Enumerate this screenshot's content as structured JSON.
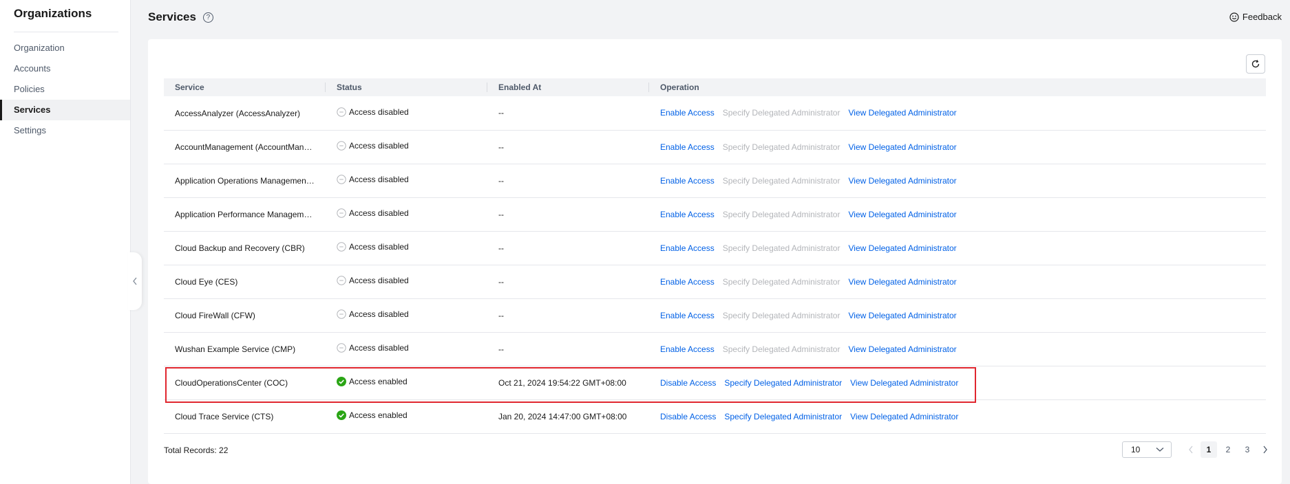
{
  "sidebar": {
    "title": "Organizations",
    "items": [
      {
        "label": "Organization"
      },
      {
        "label": "Accounts"
      },
      {
        "label": "Policies"
      },
      {
        "label": "Services"
      },
      {
        "label": "Settings"
      }
    ],
    "active_index": 3
  },
  "header": {
    "title": "Services",
    "help_icon": "question-icon",
    "feedback_label": "Feedback"
  },
  "table": {
    "columns": [
      "Service",
      "Status",
      "Enabled At",
      "Operation"
    ],
    "rows": [
      {
        "service": "AccessAnalyzer (AccessAnalyzer)",
        "status": "Access disabled",
        "enabled_at": "--",
        "op1": "Enable Access",
        "op2": "Specify Delegated Administrator",
        "op3": "View Delegated Administrator"
      },
      {
        "service": "AccountManagement (AccountManagement)",
        "status": "Access disabled",
        "enabled_at": "--",
        "op1": "Enable Access",
        "op2": "Specify Delegated Administrator",
        "op3": "View Delegated Administrator"
      },
      {
        "service": "Application Operations Management (AOM)",
        "status": "Access disabled",
        "enabled_at": "--",
        "op1": "Enable Access",
        "op2": "Specify Delegated Administrator",
        "op3": "View Delegated Administrator"
      },
      {
        "service": "Application Performance Management (APM)",
        "status": "Access disabled",
        "enabled_at": "--",
        "op1": "Enable Access",
        "op2": "Specify Delegated Administrator",
        "op3": "View Delegated Administrator"
      },
      {
        "service": "Cloud Backup and Recovery (CBR)",
        "status": "Access disabled",
        "enabled_at": "--",
        "op1": "Enable Access",
        "op2": "Specify Delegated Administrator",
        "op3": "View Delegated Administrator"
      },
      {
        "service": "Cloud Eye (CES)",
        "status": "Access disabled",
        "enabled_at": "--",
        "op1": "Enable Access",
        "op2": "Specify Delegated Administrator",
        "op3": "View Delegated Administrator"
      },
      {
        "service": "Cloud FireWall (CFW)",
        "status": "Access disabled",
        "enabled_at": "--",
        "op1": "Enable Access",
        "op2": "Specify Delegated Administrator",
        "op3": "View Delegated Administrator"
      },
      {
        "service": "Wushan Example Service (CMP)",
        "status": "Access disabled",
        "enabled_at": "--",
        "op1": "Enable Access",
        "op2": "Specify Delegated Administrator",
        "op3": "View Delegated Administrator"
      },
      {
        "service": "CloudOperationsCenter (COC)",
        "status": "Access enabled",
        "enabled_at": "Oct 21, 2024 19:54:22 GMT+08:00",
        "op1": "Disable Access",
        "op2": "Specify Delegated Administrator",
        "op3": "View Delegated Administrator"
      },
      {
        "service": "Cloud Trace Service (CTS)",
        "status": "Access enabled",
        "enabled_at": "Jan 20, 2024 14:47:00 GMT+08:00",
        "op1": "Disable Access",
        "op2": "Specify Delegated Administrator",
        "op3": "View Delegated Administrator"
      }
    ]
  },
  "footer": {
    "total_label": "Total Records: 22",
    "page_size": "10",
    "pages": [
      "1",
      "2",
      "3"
    ],
    "current_page": "1"
  },
  "colors": {
    "link": "#0060e6",
    "disabled_link": "#b3b5b9",
    "enabled_status": "#2aa515",
    "highlight": "#e0262e"
  }
}
